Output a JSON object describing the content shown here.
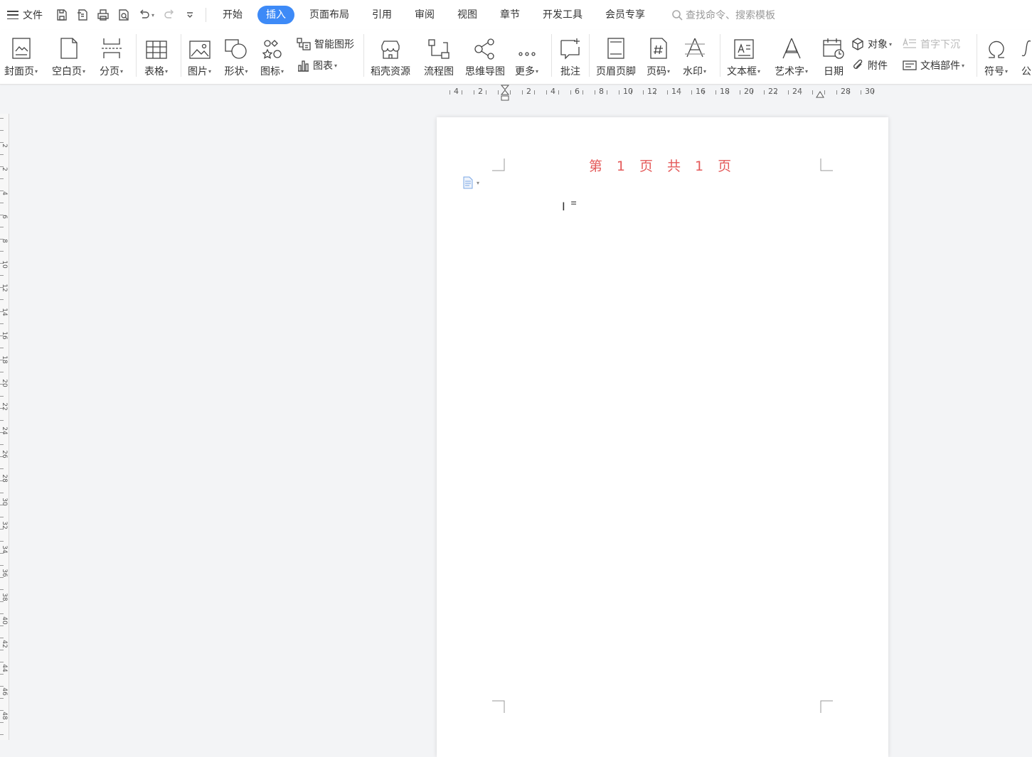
{
  "menubar": {
    "file_label": "文件",
    "tabs": [
      {
        "label": "开始",
        "active": false
      },
      {
        "label": "插入",
        "active": true
      },
      {
        "label": "页面布局",
        "active": false
      },
      {
        "label": "引用",
        "active": false
      },
      {
        "label": "审阅",
        "active": false
      },
      {
        "label": "视图",
        "active": false
      },
      {
        "label": "章节",
        "active": false
      },
      {
        "label": "开发工具",
        "active": false
      },
      {
        "label": "会员专享",
        "active": false
      }
    ],
    "search_placeholder": "查找命令、搜索模板"
  },
  "ribbon": {
    "cover_page": "封面页",
    "blank_page": "空白页",
    "page_break": "分页",
    "table": "表格",
    "picture": "图片",
    "shape": "形状",
    "icon": "图标",
    "smart_art": "智能图形",
    "chart": "图表",
    "docer_resources": "稻壳资源",
    "flowchart": "流程图",
    "mind_map": "思维导图",
    "more": "更多",
    "comment": "批注",
    "header_footer": "页眉页脚",
    "page_number": "页码",
    "watermark": "水印",
    "text_box": "文本框",
    "word_art": "艺术字",
    "date": "日期",
    "object": "对象",
    "attachment": "附件",
    "drop_cap": "首字下沉",
    "doc_parts": "文档部件",
    "symbol": "符号",
    "formula": "公"
  },
  "ruler": {
    "h_labels": [
      "4",
      "2",
      "2",
      "4",
      "6",
      "8",
      "10",
      "12",
      "14",
      "16",
      "18",
      "20",
      "22",
      "24",
      "28",
      "30"
    ],
    "v_labels": [
      "2",
      "2",
      "4",
      "6",
      "8",
      "10",
      "12",
      "14",
      "16",
      "18",
      "20",
      "22",
      "24",
      "26",
      "28",
      "30",
      "32",
      "34",
      "36",
      "38",
      "40",
      "42",
      "44",
      "46",
      "48"
    ]
  },
  "page": {
    "header_text": "第 1 页 共 1 页"
  },
  "colors": {
    "accent": "#3d8af7",
    "header_text": "#e45a5a"
  }
}
